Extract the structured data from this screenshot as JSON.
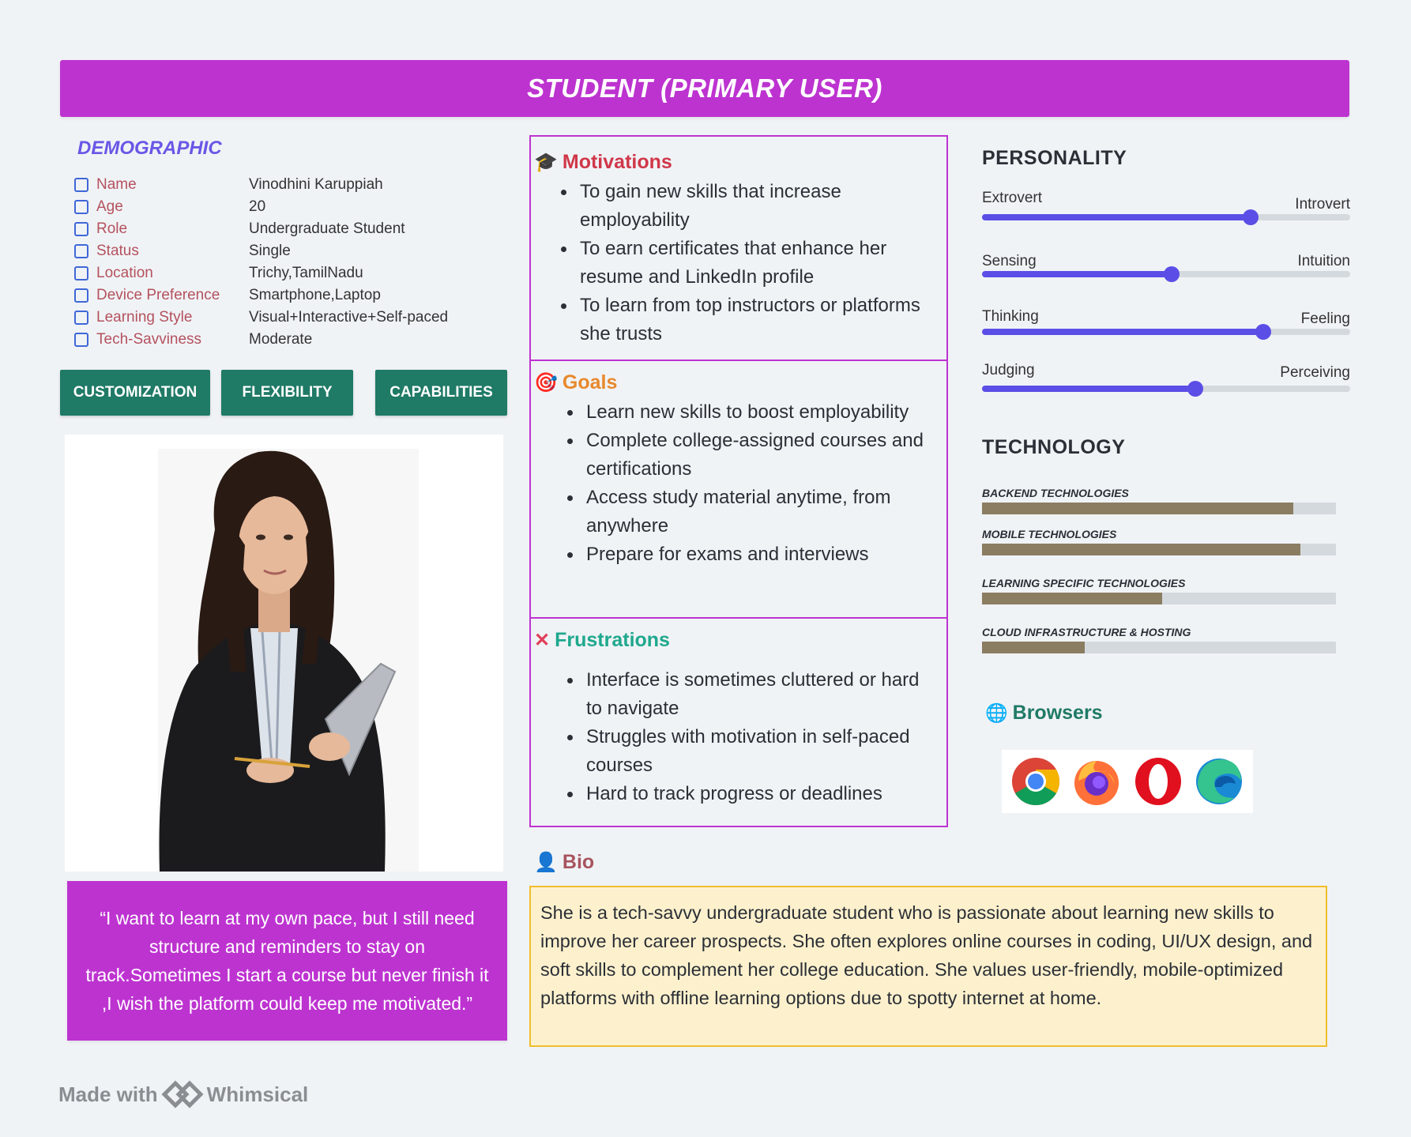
{
  "header": {
    "title": "STUDENT (PRIMARY USER)"
  },
  "demographic": {
    "title": "DEMOGRAPHIC",
    "rows": [
      {
        "label": "Name",
        "value": "Vinodhini Karuppiah"
      },
      {
        "label": "Age",
        "value": "20"
      },
      {
        "label": "Role",
        "value": "Undergraduate Student"
      },
      {
        "label": "Status",
        "value": "Single"
      },
      {
        "label": "Location",
        "value": "Trichy,TamilNadu"
      },
      {
        "label": "Device Preference",
        "value": "Smartphone,Laptop"
      },
      {
        "label": "Learning Style",
        "value": "Visual+Interactive+Self-paced"
      },
      {
        "label": "Tech-Savviness",
        "value": "Moderate"
      }
    ]
  },
  "tags": [
    "CUSTOMIZATION",
    "FLEXIBILITY",
    "CAPABILITIES"
  ],
  "quote": "“I want to learn at my own pace, but I still need structure and reminders to stay on track.Sometimes I start a course but never finish it ,I wish the platform could keep me motivated.”",
  "motivations": {
    "title": "Motivations",
    "icon": "graduation-cap-icon",
    "color": "#d0374a",
    "items": [
      "To gain new skills that increase employability",
      "To earn certificates that enhance her resume and LinkedIn profile",
      "To learn from top instructors or platforms she trusts"
    ]
  },
  "goals": {
    "title": "Goals",
    "icon": "target-icon",
    "color": "#e8892d",
    "items": [
      "Learn new skills to boost employability",
      "Complete college-assigned courses and certifications",
      "Access study material anytime, from anywhere",
      "Prepare for exams and interviews"
    ]
  },
  "frustrations": {
    "title": "Frustrations",
    "icon": "cross-icon",
    "color": "#1fa88d",
    "items": [
      "Interface is sometimes cluttered or hard to navigate",
      "Struggles with motivation in self-paced courses",
      "Hard to track progress or deadlines"
    ]
  },
  "personality": {
    "title": "PERSONALITY",
    "accent": "#5b4ee6",
    "traits": [
      {
        "left": "Extrovert",
        "right": "Introvert",
        "value": 0.73
      },
      {
        "left": "Sensing",
        "right": "Intuition",
        "value": 0.515
      },
      {
        "left": "Thinking",
        "right": "Feeling",
        "value": 0.765
      },
      {
        "left": "Judging",
        "right": "Perceiving",
        "value": 0.58
      }
    ]
  },
  "technology": {
    "title": "TECHNOLOGY",
    "bar_color": "#8b7d62",
    "items": [
      {
        "name": "BACKEND TECHNOLOGIES",
        "value": 0.88
      },
      {
        "name": "MOBILE TECHNOLOGIES",
        "value": 0.9
      },
      {
        "name": "LEARNING SPECIFIC TECHNOLOGIES",
        "value": 0.51
      },
      {
        "name": "CLOUD INFRASTRUCTURE & HOSTING",
        "value": 0.29
      }
    ]
  },
  "browsers": {
    "title": "Browsers",
    "icon": "globe-icon",
    "items": [
      "chrome-icon",
      "firefox-icon",
      "opera-icon",
      "edge-icon"
    ]
  },
  "bio": {
    "title": "Bio",
    "icon": "user-icon",
    "text": "She is a tech-savvy undergraduate student who is passionate about learning new skills to improve her career prospects. She often explores online courses in coding, UI/UX design, and soft skills to complement her college education. She values user-friendly, mobile-optimized platforms with offline learning options due to spotty internet at home."
  },
  "footer": {
    "made_with": "Made with",
    "brand": "Whimsical"
  }
}
